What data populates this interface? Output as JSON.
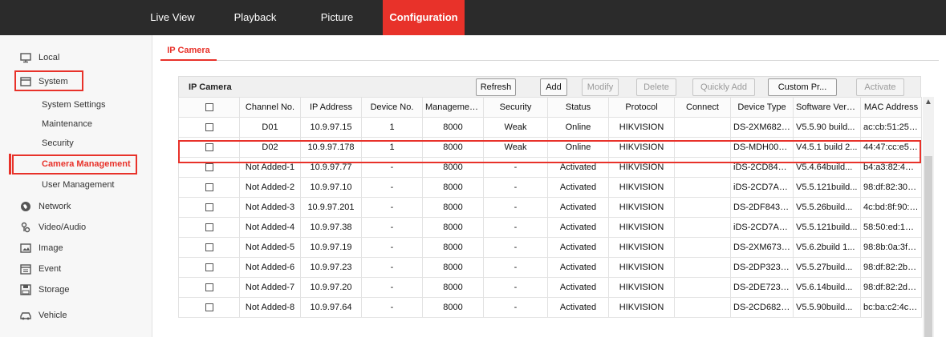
{
  "top_nav": {
    "items": [
      {
        "label": "Live View",
        "active": false
      },
      {
        "label": "Playback",
        "active": false
      },
      {
        "label": "Picture",
        "active": false
      },
      {
        "label": "Configuration",
        "active": true
      }
    ]
  },
  "sidebar": {
    "items": [
      {
        "label": "Local",
        "icon": "monitor-icon"
      },
      {
        "label": "System",
        "icon": "window-icon",
        "highlighted": true
      },
      {
        "label": "Network",
        "icon": "globe-icon"
      },
      {
        "label": "Video/Audio",
        "icon": "microphone-icon"
      },
      {
        "label": "Image",
        "icon": "image-icon"
      },
      {
        "label": "Event",
        "icon": "calendar-icon"
      },
      {
        "label": "Storage",
        "icon": "storage-icon"
      },
      {
        "label": "Vehicle",
        "icon": "vehicle-icon"
      }
    ],
    "system_subitems": [
      {
        "label": "System Settings"
      },
      {
        "label": "Maintenance"
      },
      {
        "label": "Security"
      },
      {
        "label": "Camera Management",
        "active": true
      },
      {
        "label": "User Management"
      }
    ]
  },
  "content": {
    "tab_label": "IP Camera",
    "toolbar": {
      "title": "IP Camera",
      "refresh": "Refresh",
      "add": "Add",
      "modify": "Modify",
      "delete": "Delete",
      "quickly_add": "Quickly Add",
      "custom": "Custom Pr...",
      "activate": "Activate"
    },
    "columns": [
      "Channel No.",
      "IP Address",
      "Device No.",
      "Management...",
      "Security",
      "Status",
      "Protocol",
      "Connect",
      "Device Type",
      "Software Vers...",
      "MAC Address"
    ],
    "rows": [
      {
        "channel": "D01",
        "ip": "10.9.97.15",
        "device_no": "1",
        "port": "8000",
        "security": "Weak",
        "status": "Online",
        "protocol": "HIKVISION",
        "connect": "",
        "device_type": "DS-2XM6825...",
        "software": "V5.5.90 build...",
        "mac": "ac:cb:51:25:a..."
      },
      {
        "channel": "D02",
        "ip": "10.9.97.178",
        "device_no": "1",
        "port": "8000",
        "security": "Weak",
        "status": "Online",
        "protocol": "HIKVISION",
        "connect": "",
        "device_type": "DS-MDH005-...",
        "software": "V4.5.1 build 2...",
        "mac": "44:47:cc:e5:6..."
      },
      {
        "channel": "Not Added-1",
        "ip": "10.9.97.77",
        "device_no": "-",
        "port": "8000",
        "security": "-",
        "status": "Activated",
        "protocol": "HIKVISION",
        "connect": "",
        "device_type": "iDS-2CD8426...",
        "software": "V5.4.64build...",
        "mac": "b4:a3:82:45:6..."
      },
      {
        "channel": "Not Added-2",
        "ip": "10.9.97.10",
        "device_no": "-",
        "port": "8000",
        "security": "-",
        "status": "Activated",
        "protocol": "HIKVISION",
        "connect": "",
        "device_type": "iDS-2CD7A46...",
        "software": "V5.5.121build...",
        "mac": "98:df:82:30:1..."
      },
      {
        "channel": "Not Added-3",
        "ip": "10.9.97.201",
        "device_no": "-",
        "port": "8000",
        "security": "-",
        "status": "Activated",
        "protocol": "HIKVISION",
        "connect": "",
        "device_type": "DS-2DF8436I...",
        "software": "V5.5.26build...",
        "mac": "4c:bd:8f:90:5..."
      },
      {
        "channel": "Not Added-4",
        "ip": "10.9.97.38",
        "device_no": "-",
        "port": "8000",
        "security": "-",
        "status": "Activated",
        "protocol": "HIKVISION",
        "connect": "",
        "device_type": "iDS-2CD7A26...",
        "software": "V5.5.121build...",
        "mac": "58:50:ed:16:7..."
      },
      {
        "channel": "Not Added-5",
        "ip": "10.9.97.19",
        "device_no": "-",
        "port": "8000",
        "security": "-",
        "status": "Activated",
        "protocol": "HIKVISION",
        "connect": "",
        "device_type": "DS-2XM6736...",
        "software": "V5.6.2build 1...",
        "mac": "98:8b:0a:3f:3..."
      },
      {
        "channel": "Not Added-6",
        "ip": "10.9.97.23",
        "device_no": "-",
        "port": "8000",
        "security": "-",
        "status": "Activated",
        "protocol": "HIKVISION",
        "connect": "",
        "device_type": "DS-2DP3236...",
        "software": "V5.5.27build...",
        "mac": "98:df:82:2b:5..."
      },
      {
        "channel": "Not Added-7",
        "ip": "10.9.97.20",
        "device_no": "-",
        "port": "8000",
        "security": "-",
        "status": "Activated",
        "protocol": "HIKVISION",
        "connect": "",
        "device_type": "DS-2DE7232I...",
        "software": "V5.6.14build...",
        "mac": "98:df:82:2d:5..."
      },
      {
        "channel": "Not Added-8",
        "ip": "10.9.97.64",
        "device_no": "-",
        "port": "8000",
        "security": "-",
        "status": "Activated",
        "protocol": "HIKVISION",
        "connect": "",
        "device_type": "DS-2CD6825...",
        "software": "V5.5.90build...",
        "mac": "bc:ba:c2:4c:4..."
      }
    ]
  },
  "colors": {
    "accent": "#e8322a",
    "topbar": "#2b2b2b"
  }
}
